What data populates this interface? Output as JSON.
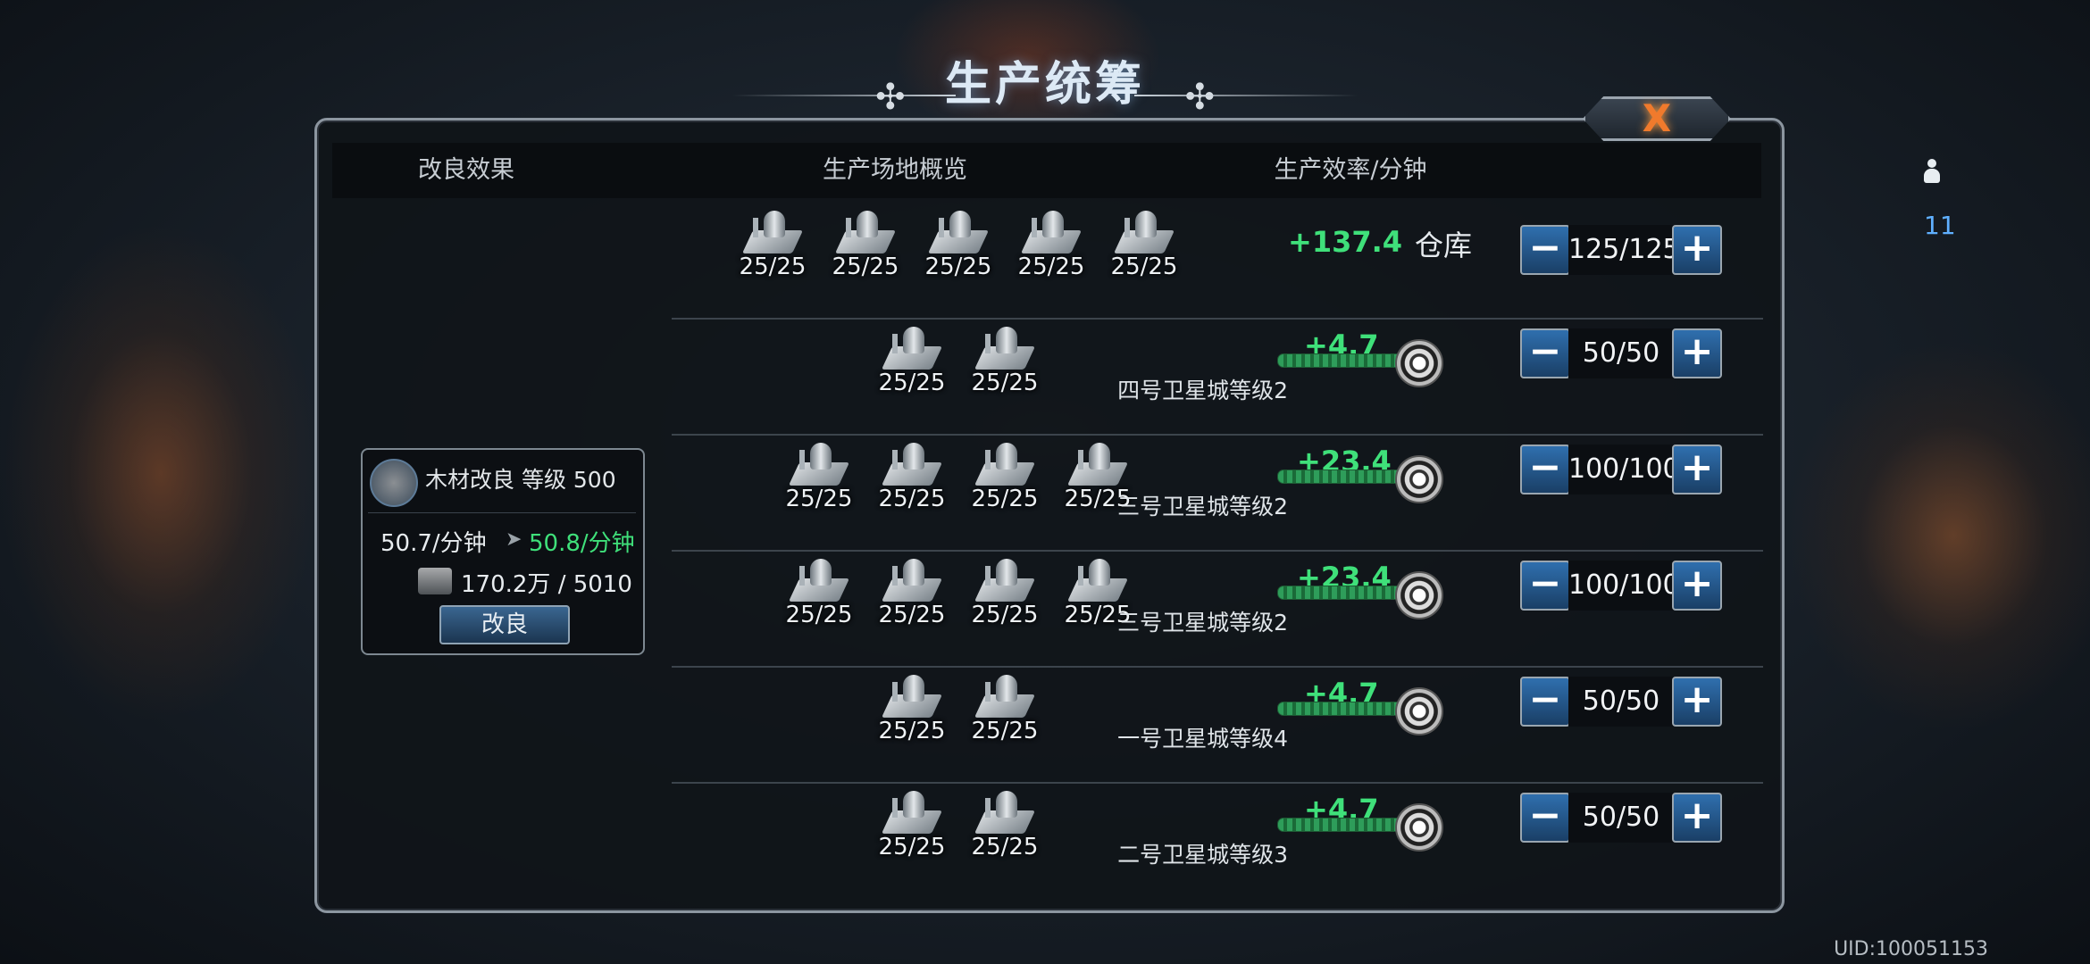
{
  "title": "生产统筹",
  "close_label": "X",
  "header": {
    "col_effect": "改良效果",
    "col_overview": "生产场地概览",
    "col_rate": "生产效率/分钟",
    "workers": "11"
  },
  "upgrade_card": {
    "title": "木材改良 等级 500",
    "current_rate": "50.7/分钟",
    "next_rate": "50.8/分钟",
    "cost": "170.2万 / 5010",
    "button": "改良"
  },
  "rows": [
    {
      "buildings": [
        "25/25",
        "25/25",
        "25/25",
        "25/25",
        "25/25"
      ],
      "rate": "+137.4",
      "label": "仓库",
      "stepper": "125/125"
    },
    {
      "buildings": [
        "25/25",
        "25/25"
      ],
      "rate": "+4.7",
      "label": "四号卫星城等级2",
      "stepper": "50/50"
    },
    {
      "buildings": [
        "25/25",
        "25/25",
        "25/25",
        "25/25"
      ],
      "rate": "+23.4",
      "label": "三号卫星城等级2",
      "stepper": "100/100"
    },
    {
      "buildings": [
        "25/25",
        "25/25",
        "25/25",
        "25/25"
      ],
      "rate": "+23.4",
      "label": "三号卫星城等级2",
      "stepper": "100/100"
    },
    {
      "buildings": [
        "25/25",
        "25/25"
      ],
      "rate": "+4.7",
      "label": "一号卫星城等级4",
      "stepper": "50/50"
    },
    {
      "buildings": [
        "25/25",
        "25/25"
      ],
      "rate": "+4.7",
      "label": "二号卫星城等级3",
      "stepper": "50/50"
    }
  ],
  "uid": "UID:100051153",
  "colors": {
    "rate_green": "#3fe07a",
    "worker_blue": "#5fb0ff",
    "close_orange": "#f07a2c"
  }
}
